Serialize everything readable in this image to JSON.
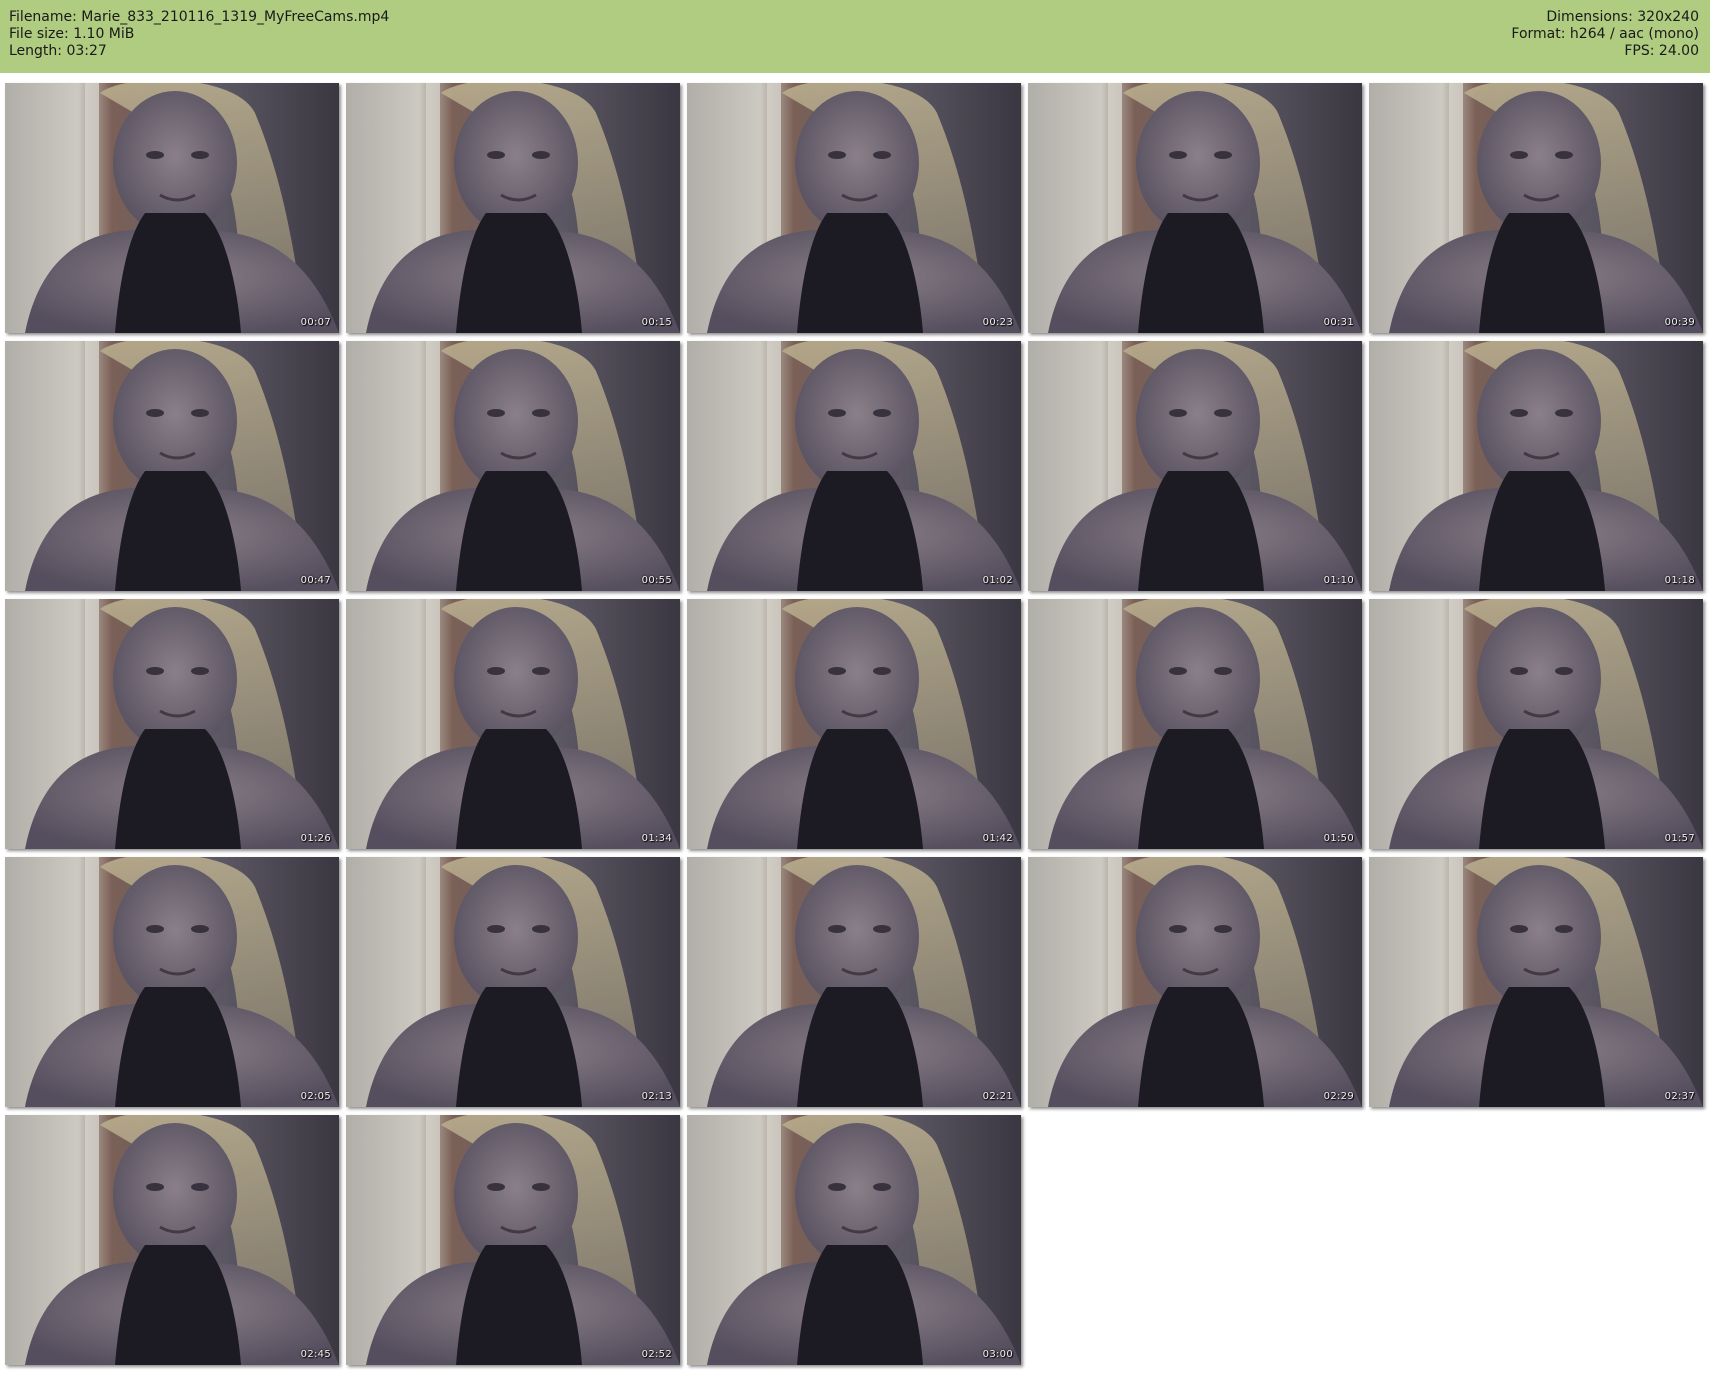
{
  "header": {
    "left": [
      "Filename: Marie_833_210116_1319_MyFreeCams.mp4",
      "File size: 1.10 MiB",
      "Length: 03:27"
    ],
    "right": [
      "Dimensions: 320x240",
      "Format: h264 / aac (mono)",
      "FPS: 24.00"
    ],
    "background_color": "#b0cc80"
  },
  "thumbnails": [
    {
      "time": "00:07"
    },
    {
      "time": "00:15"
    },
    {
      "time": "00:23"
    },
    {
      "time": "00:31"
    },
    {
      "time": "00:39"
    },
    {
      "time": "00:47"
    },
    {
      "time": "00:55"
    },
    {
      "time": "01:02"
    },
    {
      "time": "01:10"
    },
    {
      "time": "01:18"
    },
    {
      "time": "01:26"
    },
    {
      "time": "01:34"
    },
    {
      "time": "01:42"
    },
    {
      "time": "01:50"
    },
    {
      "time": "01:57"
    },
    {
      "time": "02:05"
    },
    {
      "time": "02:13"
    },
    {
      "time": "02:21"
    },
    {
      "time": "02:29"
    },
    {
      "time": "02:37"
    },
    {
      "time": "02:45"
    },
    {
      "time": "02:52"
    },
    {
      "time": "03:00"
    }
  ]
}
